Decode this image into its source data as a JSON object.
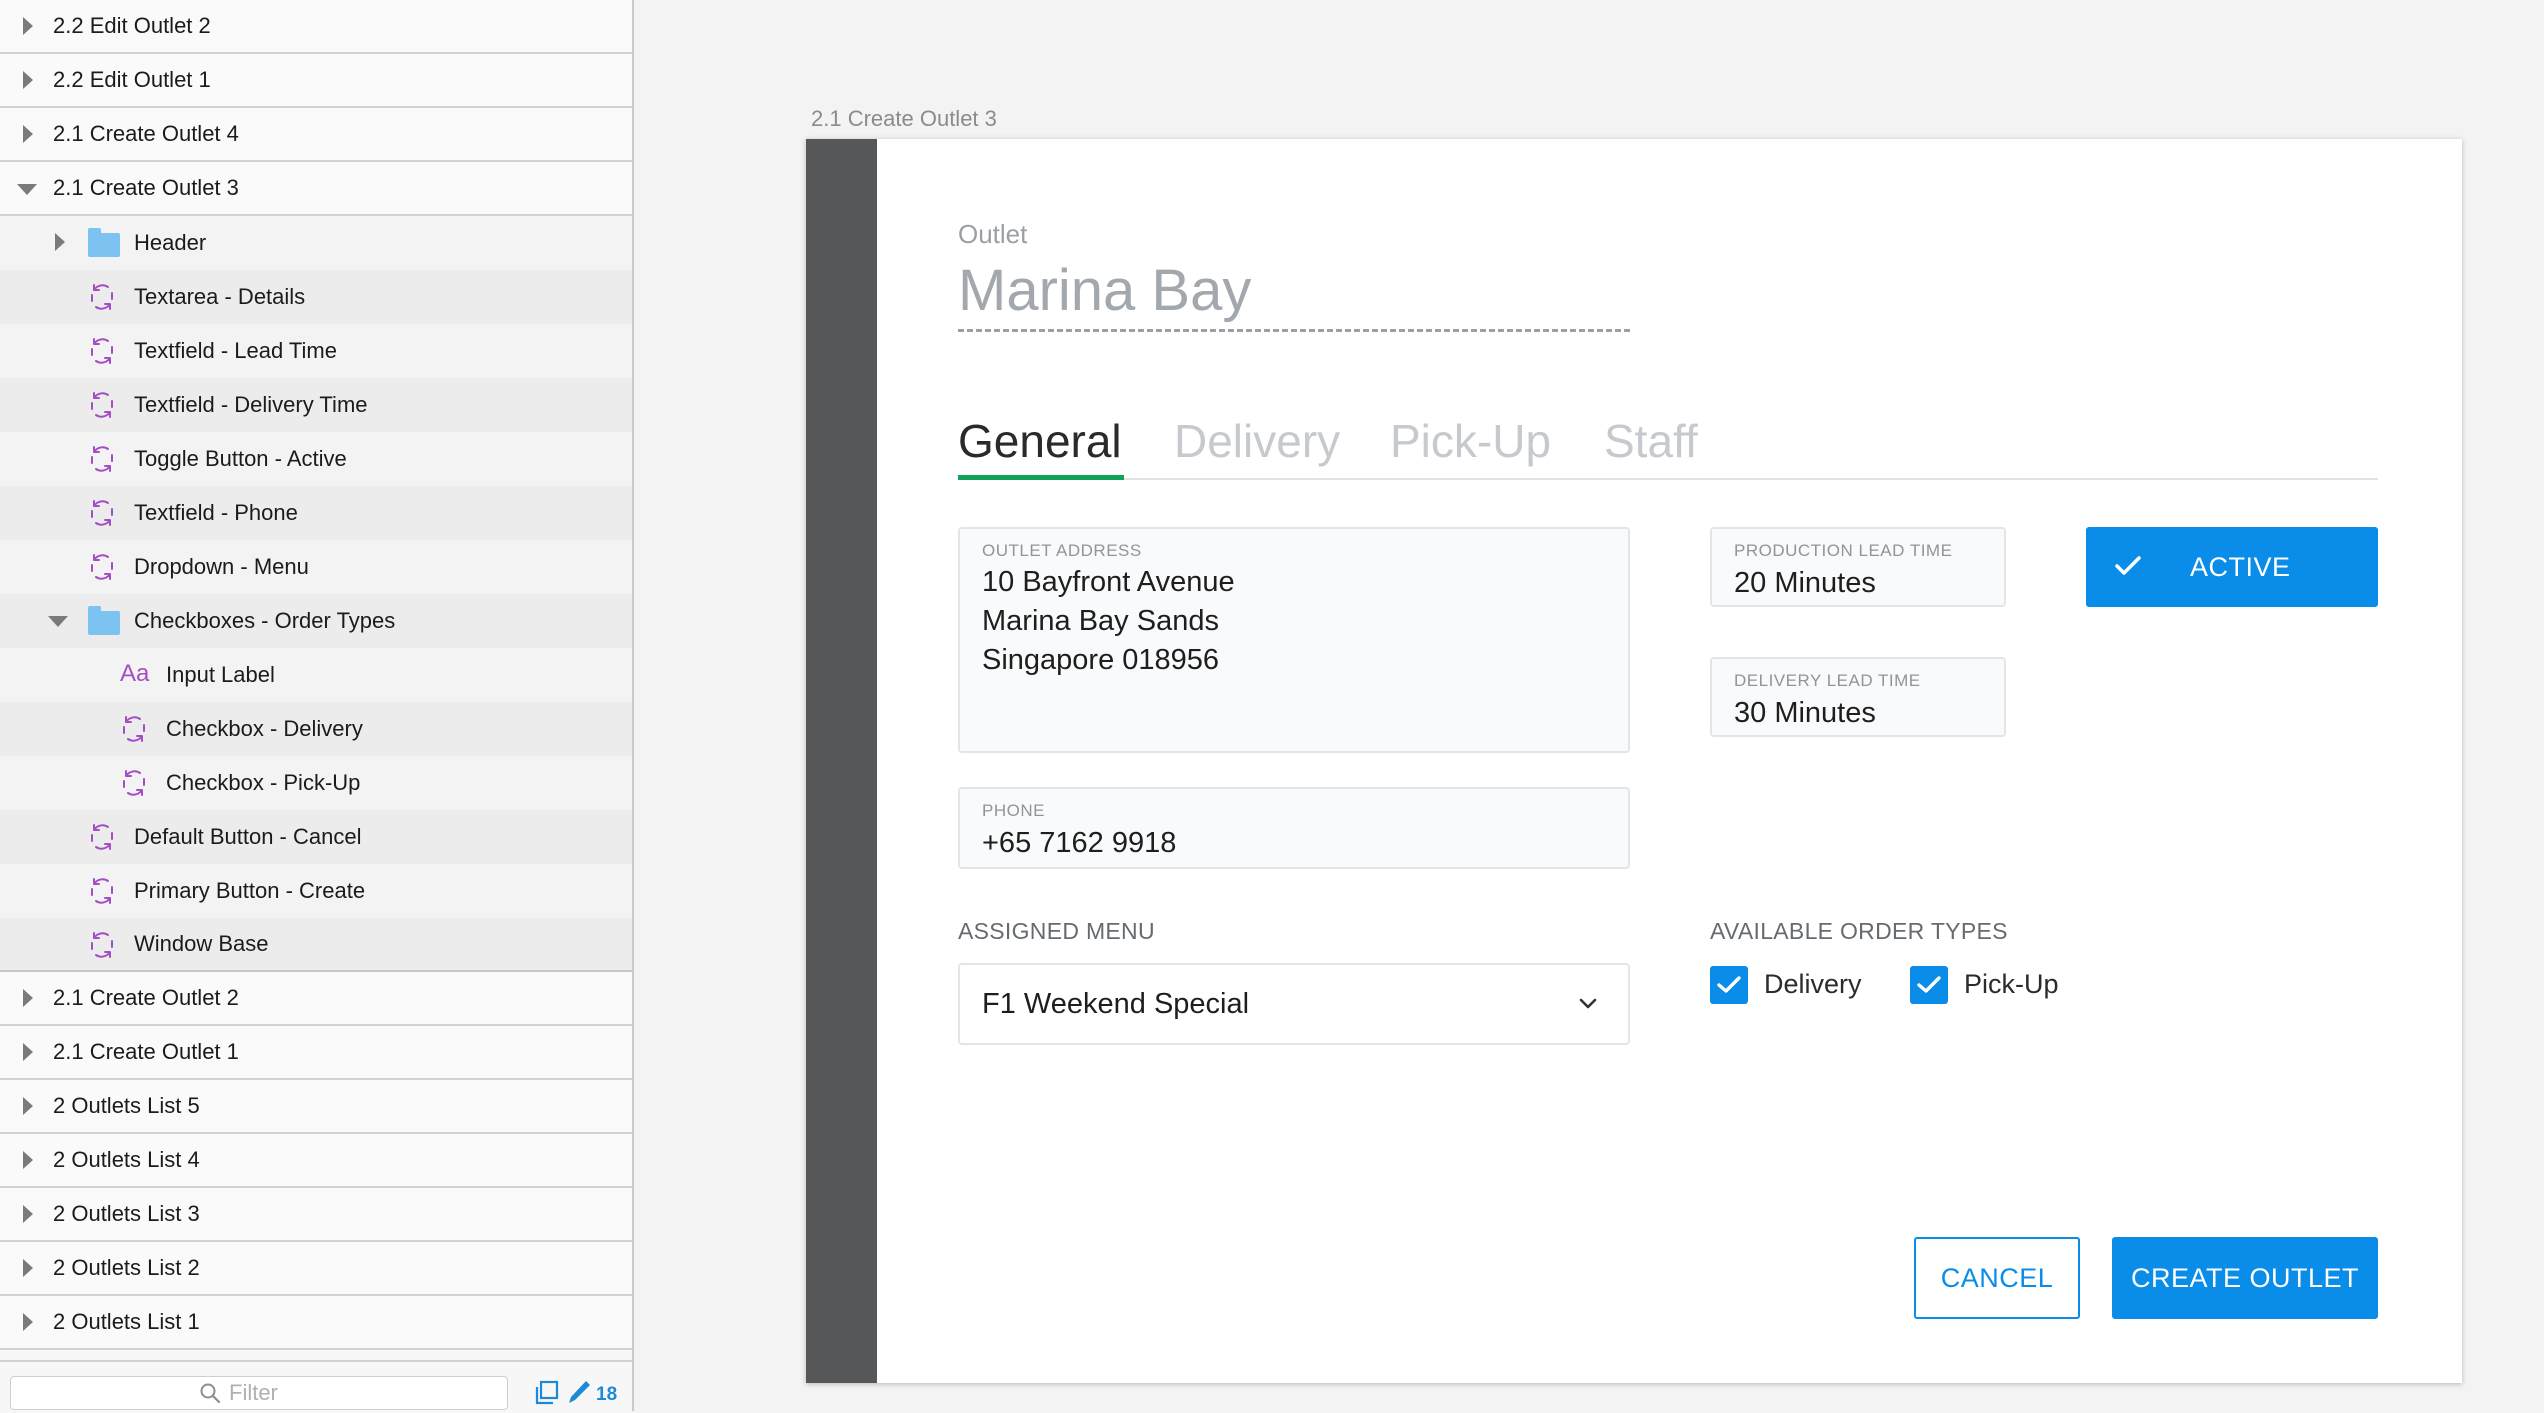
{
  "sidebar": {
    "rows": [
      {
        "label": "2.2 Edit Outlet 2",
        "icon": "triangle-right-icon"
      },
      {
        "label": "2.2 Edit Outlet 1",
        "icon": "triangle-right-icon"
      },
      {
        "label": "2.1 Create Outlet 4",
        "icon": "triangle-right-icon"
      },
      {
        "label": "2.1 Create Outlet 3",
        "icon": "triangle-down-icon"
      },
      {
        "label": "Header",
        "icon": "folder-icon"
      },
      {
        "label": "Textarea - Details",
        "icon": "symbol-icon"
      },
      {
        "label": "Textfield - Lead Time",
        "icon": "symbol-icon"
      },
      {
        "label": "Textfield - Delivery Time",
        "icon": "symbol-icon"
      },
      {
        "label": "Toggle Button - Active",
        "icon": "symbol-icon"
      },
      {
        "label": "Textfield - Phone",
        "icon": "symbol-icon"
      },
      {
        "label": "Dropdown - Menu",
        "icon": "symbol-icon"
      },
      {
        "label": "Checkboxes - Order Types",
        "icon": "folder-icon"
      },
      {
        "label": "Input Label",
        "icon": "text-layer-icon",
        "glyph": "Aa"
      },
      {
        "label": "Checkbox - Delivery",
        "icon": "symbol-icon"
      },
      {
        "label": "Checkbox - Pick-Up",
        "icon": "symbol-icon"
      },
      {
        "label": "Default Button - Cancel",
        "icon": "symbol-icon"
      },
      {
        "label": "Primary Button - Create",
        "icon": "symbol-icon"
      },
      {
        "label": "Window Base",
        "icon": "symbol-icon"
      },
      {
        "label": "2.1 Create Outlet 2",
        "icon": "triangle-right-icon"
      },
      {
        "label": "2.1 Create Outlet 1",
        "icon": "triangle-right-icon"
      },
      {
        "label": "2 Outlets List 5",
        "icon": "triangle-right-icon"
      },
      {
        "label": "2 Outlets List 4",
        "icon": "triangle-right-icon"
      },
      {
        "label": "2 Outlets List 3",
        "icon": "triangle-right-icon"
      },
      {
        "label": "2 Outlets List 2",
        "icon": "triangle-right-icon"
      },
      {
        "label": "2 Outlets List 1",
        "icon": "triangle-right-icon"
      }
    ],
    "filter": {
      "placeholder": "Filter",
      "icon": "search-icon"
    },
    "footer": {
      "pages_icon": "pages-icon",
      "edit_icon": "pencil-icon",
      "edit_count": "18"
    }
  },
  "artboard": {
    "name": "2.1 Create Outlet 3",
    "outlet_caption": "Outlet",
    "outlet_name": "Marina Bay",
    "tabs": [
      {
        "label": "General",
        "active": true
      },
      {
        "label": "Delivery",
        "active": false
      },
      {
        "label": "Pick-Up",
        "active": false
      },
      {
        "label": "Staff",
        "active": false
      }
    ],
    "address": {
      "label": "OUTLET ADDRESS",
      "value": "10 Bayfront Avenue\nMarina Bay Sands\nSingapore 018956"
    },
    "production_lead_time": {
      "label": "PRODUCTION LEAD TIME",
      "value": "20 Minutes"
    },
    "delivery_lead_time": {
      "label": "DELIVERY LEAD TIME",
      "value": "30 Minutes"
    },
    "active_toggle": {
      "label": "ACTIVE",
      "icon": "check-icon"
    },
    "phone": {
      "label": "PHONE",
      "value": "+65 7162 9918"
    },
    "assigned_menu": {
      "label": "ASSIGNED MENU",
      "value": "F1 Weekend Special",
      "icon": "chevron-down-icon"
    },
    "order_types": {
      "label": "AVAILABLE ORDER TYPES",
      "options": [
        {
          "label": "Delivery",
          "checked": true
        },
        {
          "label": "Pick-Up",
          "checked": true
        }
      ]
    },
    "cancel_label": "CANCEL",
    "create_label": "CREATE OUTLET"
  },
  "colors": {
    "primary": "#0a8de8",
    "tab_active_indicator": "#11a25a",
    "window_base_strip": "#555758",
    "symbol_icon": "#a34ec4",
    "folder_icon": "#7cc3f2"
  }
}
